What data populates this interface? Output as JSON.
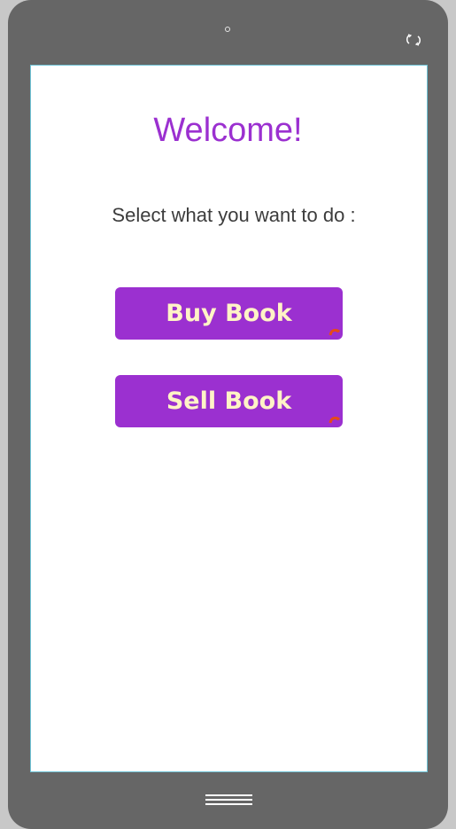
{
  "screen": {
    "title": "Welcome!",
    "prompt": "Select what you want to do :"
  },
  "buttons": {
    "buy_label": "Buy Book",
    "sell_label": "Sell Book"
  },
  "colors": {
    "accent": "#9b30d0",
    "button_text": "#fff3c6",
    "device_frame": "#666666",
    "screen_border": "#6fc3d6"
  },
  "icons": {
    "camera": "camera-icon",
    "rotate": "rotate-icon",
    "link": "link-icon",
    "home": "home-menu-icon"
  }
}
